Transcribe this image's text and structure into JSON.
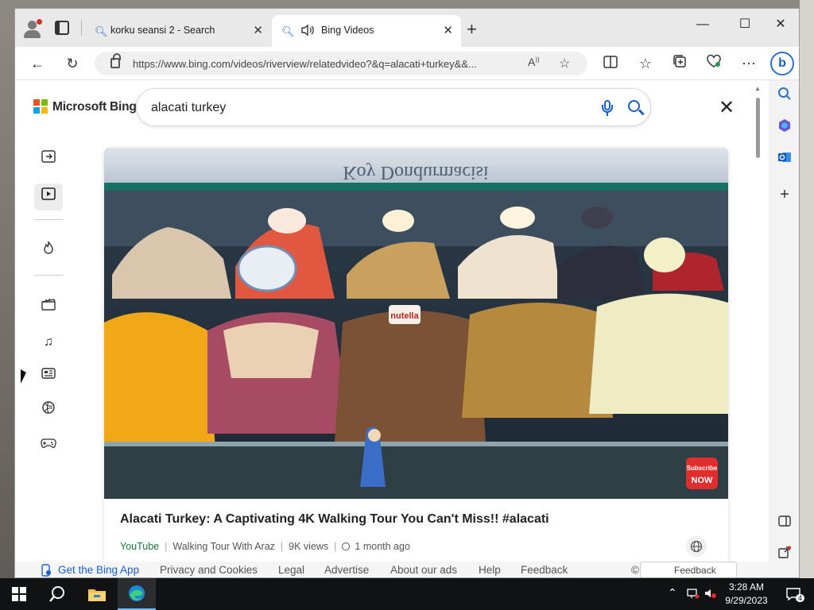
{
  "browser": {
    "tabs": [
      {
        "title": "korku seansi 2 - Search",
        "active": false
      },
      {
        "title": "Bing Videos",
        "active": true
      }
    ],
    "url": "https://www.bing.com/videos/riverview/relatedvideo?&q=alacati+turkey&&..."
  },
  "bing": {
    "brand": "Microsoft Bing",
    "query": "alacati turkey"
  },
  "video": {
    "title": "Alacati Turkey: A Captivating 4K Walking Tour You Can't Miss!! #alacati",
    "source": "YouTube",
    "channel": "Walking Tour With Araz",
    "views": "9K views",
    "age": "1 month ago",
    "overlay_sign": "Koy Dondurmacisi",
    "tub_label": "nutella",
    "subscribe_badge": [
      "Subscribe",
      "NOW"
    ]
  },
  "footer": {
    "links": [
      "Get the Bing App",
      "Privacy and Cookies",
      "Legal",
      "Advertise",
      "About our ads",
      "Help",
      "Feedback"
    ],
    "copyright": "©",
    "feedback_button": "Feedback"
  },
  "taskbar": {
    "time": "3:28 AM",
    "date": "9/29/2023",
    "notifications": "4"
  },
  "colors": {
    "accent": "#1a5fc9",
    "source_green": "#1b7a3a",
    "taskbar": "#101214"
  },
  "icons": {
    "left_nav": [
      "sidebar-toggle-icon",
      "video-icon",
      "flame-icon",
      "film-icon",
      "music-icon",
      "news-icon",
      "sports-icon",
      "gamepad-icon"
    ],
    "right_rail": [
      "search-icon",
      "copilot-icon",
      "outlook-icon",
      "plus-icon",
      "sidebar-icon",
      "external-link-icon",
      "settings-icon"
    ]
  }
}
